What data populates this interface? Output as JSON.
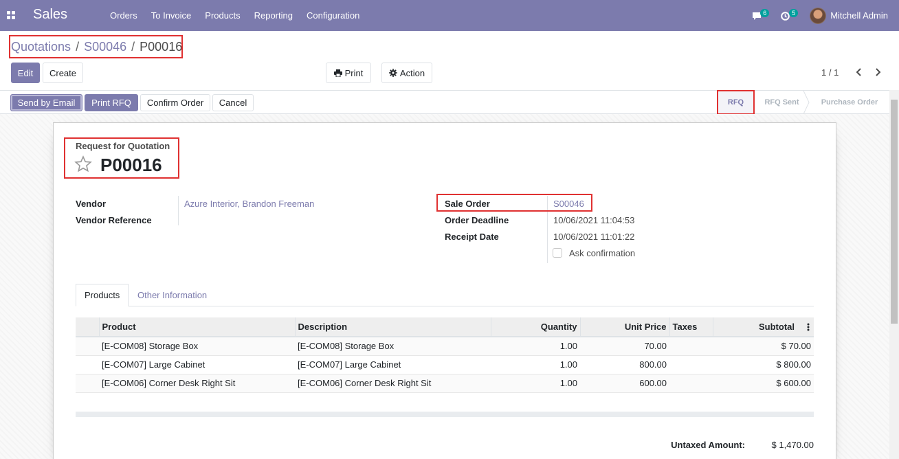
{
  "navbar": {
    "brand": "Sales",
    "menu": [
      "Orders",
      "To Invoice",
      "Products",
      "Reporting",
      "Configuration"
    ],
    "messages_count": "6",
    "activities_count": "5",
    "user": "Mitchell Admin"
  },
  "breadcrumb": [
    "Quotations",
    "S00046",
    "P00016"
  ],
  "buttons": {
    "edit": "Edit",
    "create": "Create",
    "print": "Print",
    "action": "Action",
    "send_email": "Send by Email",
    "print_rfq": "Print RFQ",
    "confirm": "Confirm Order",
    "cancel": "Cancel"
  },
  "pager": "1 / 1",
  "stages": [
    "RFQ",
    "RFQ Sent",
    "Purchase Order"
  ],
  "doc": {
    "label": "Request for Quotation",
    "name": "P00016"
  },
  "fields": {
    "vendor_label": "Vendor",
    "vendor_value": "Azure Interior, Brandon Freeman",
    "vendor_ref_label": "Vendor Reference",
    "sale_order_label": "Sale Order",
    "sale_order_value": "S00046",
    "deadline_label": "Order Deadline",
    "deadline_value": "10/06/2021 11:04:53",
    "receipt_label": "Receipt Date",
    "receipt_value": "10/06/2021 11:01:22",
    "ask_confirmation": "Ask confirmation"
  },
  "tabs": [
    "Products",
    "Other Information"
  ],
  "table": {
    "headers": [
      "Product",
      "Description",
      "Quantity",
      "Unit Price",
      "Taxes",
      "Subtotal"
    ],
    "rows": [
      {
        "product": "[E-COM08] Storage Box",
        "description": "[E-COM08] Storage Box",
        "quantity": "1.00",
        "price": "70.00",
        "taxes": "",
        "subtotal": "$ 70.00"
      },
      {
        "product": "[E-COM07] Large Cabinet",
        "description": "[E-COM07] Large Cabinet",
        "quantity": "1.00",
        "price": "800.00",
        "taxes": "",
        "subtotal": "$ 800.00"
      },
      {
        "product": "[E-COM06] Corner Desk Right Sit",
        "description": "[E-COM06] Corner Desk Right Sit",
        "quantity": "1.00",
        "price": "600.00",
        "taxes": "",
        "subtotal": "$ 600.00"
      }
    ]
  },
  "totals": {
    "untaxed_label": "Untaxed Amount:",
    "untaxed_value": "$ 1,470.00"
  },
  "colors": {
    "brand": "#7c7bad",
    "highlight": "#e03131"
  }
}
